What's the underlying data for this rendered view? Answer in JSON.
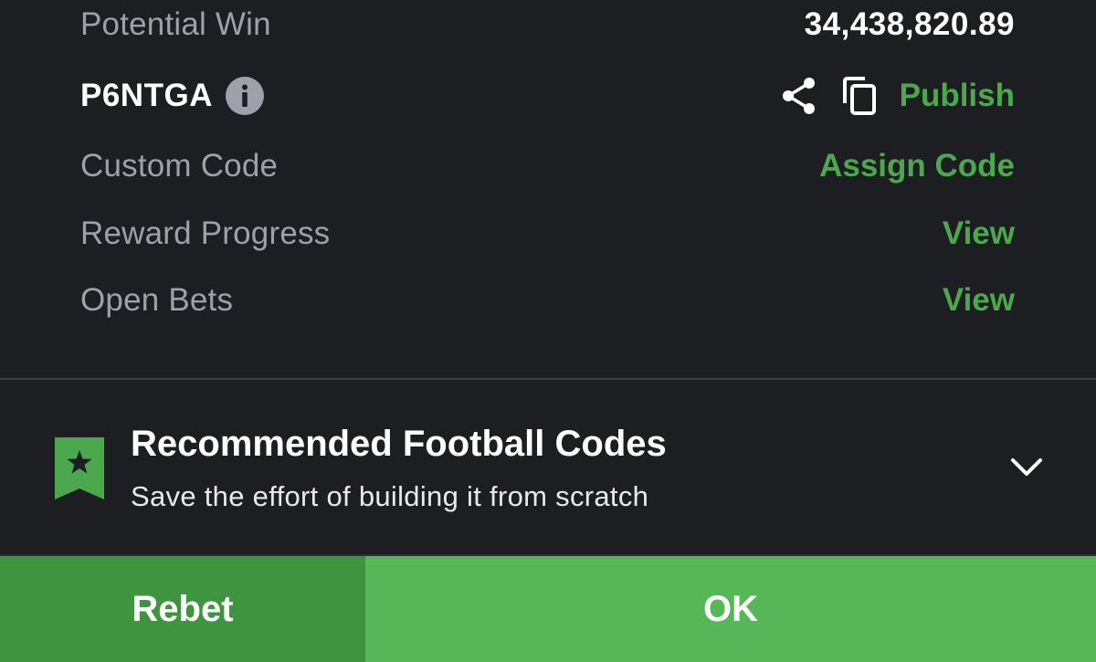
{
  "summary": {
    "potential_win_label": "Potential Win",
    "potential_win_value": "34,438,820.89",
    "booking_code": "P6NTGA",
    "publish_label": "Publish",
    "custom_code_label": "Custom Code",
    "assign_code_label": "Assign Code",
    "reward_progress_label": "Reward Progress",
    "reward_progress_action": "View",
    "open_bets_label": "Open Bets",
    "open_bets_action": "View"
  },
  "recommended": {
    "title": "Recommended Football Codes",
    "subtitle": "Save the effort of building it from scratch"
  },
  "actions": {
    "rebet_label": "Rebet",
    "ok_label": "OK"
  },
  "icons": {
    "info": "info-icon",
    "share": "share-icon",
    "copy": "copy-icon",
    "bookmark": "bookmark-star-icon",
    "chevron": "chevron-down-icon"
  },
  "colors": {
    "background": "#1d1e22",
    "accent_green": "#4ca84c",
    "ok_button": "#56b756",
    "rebet_button": "#3f943f",
    "muted_text": "#9ea1aa"
  }
}
